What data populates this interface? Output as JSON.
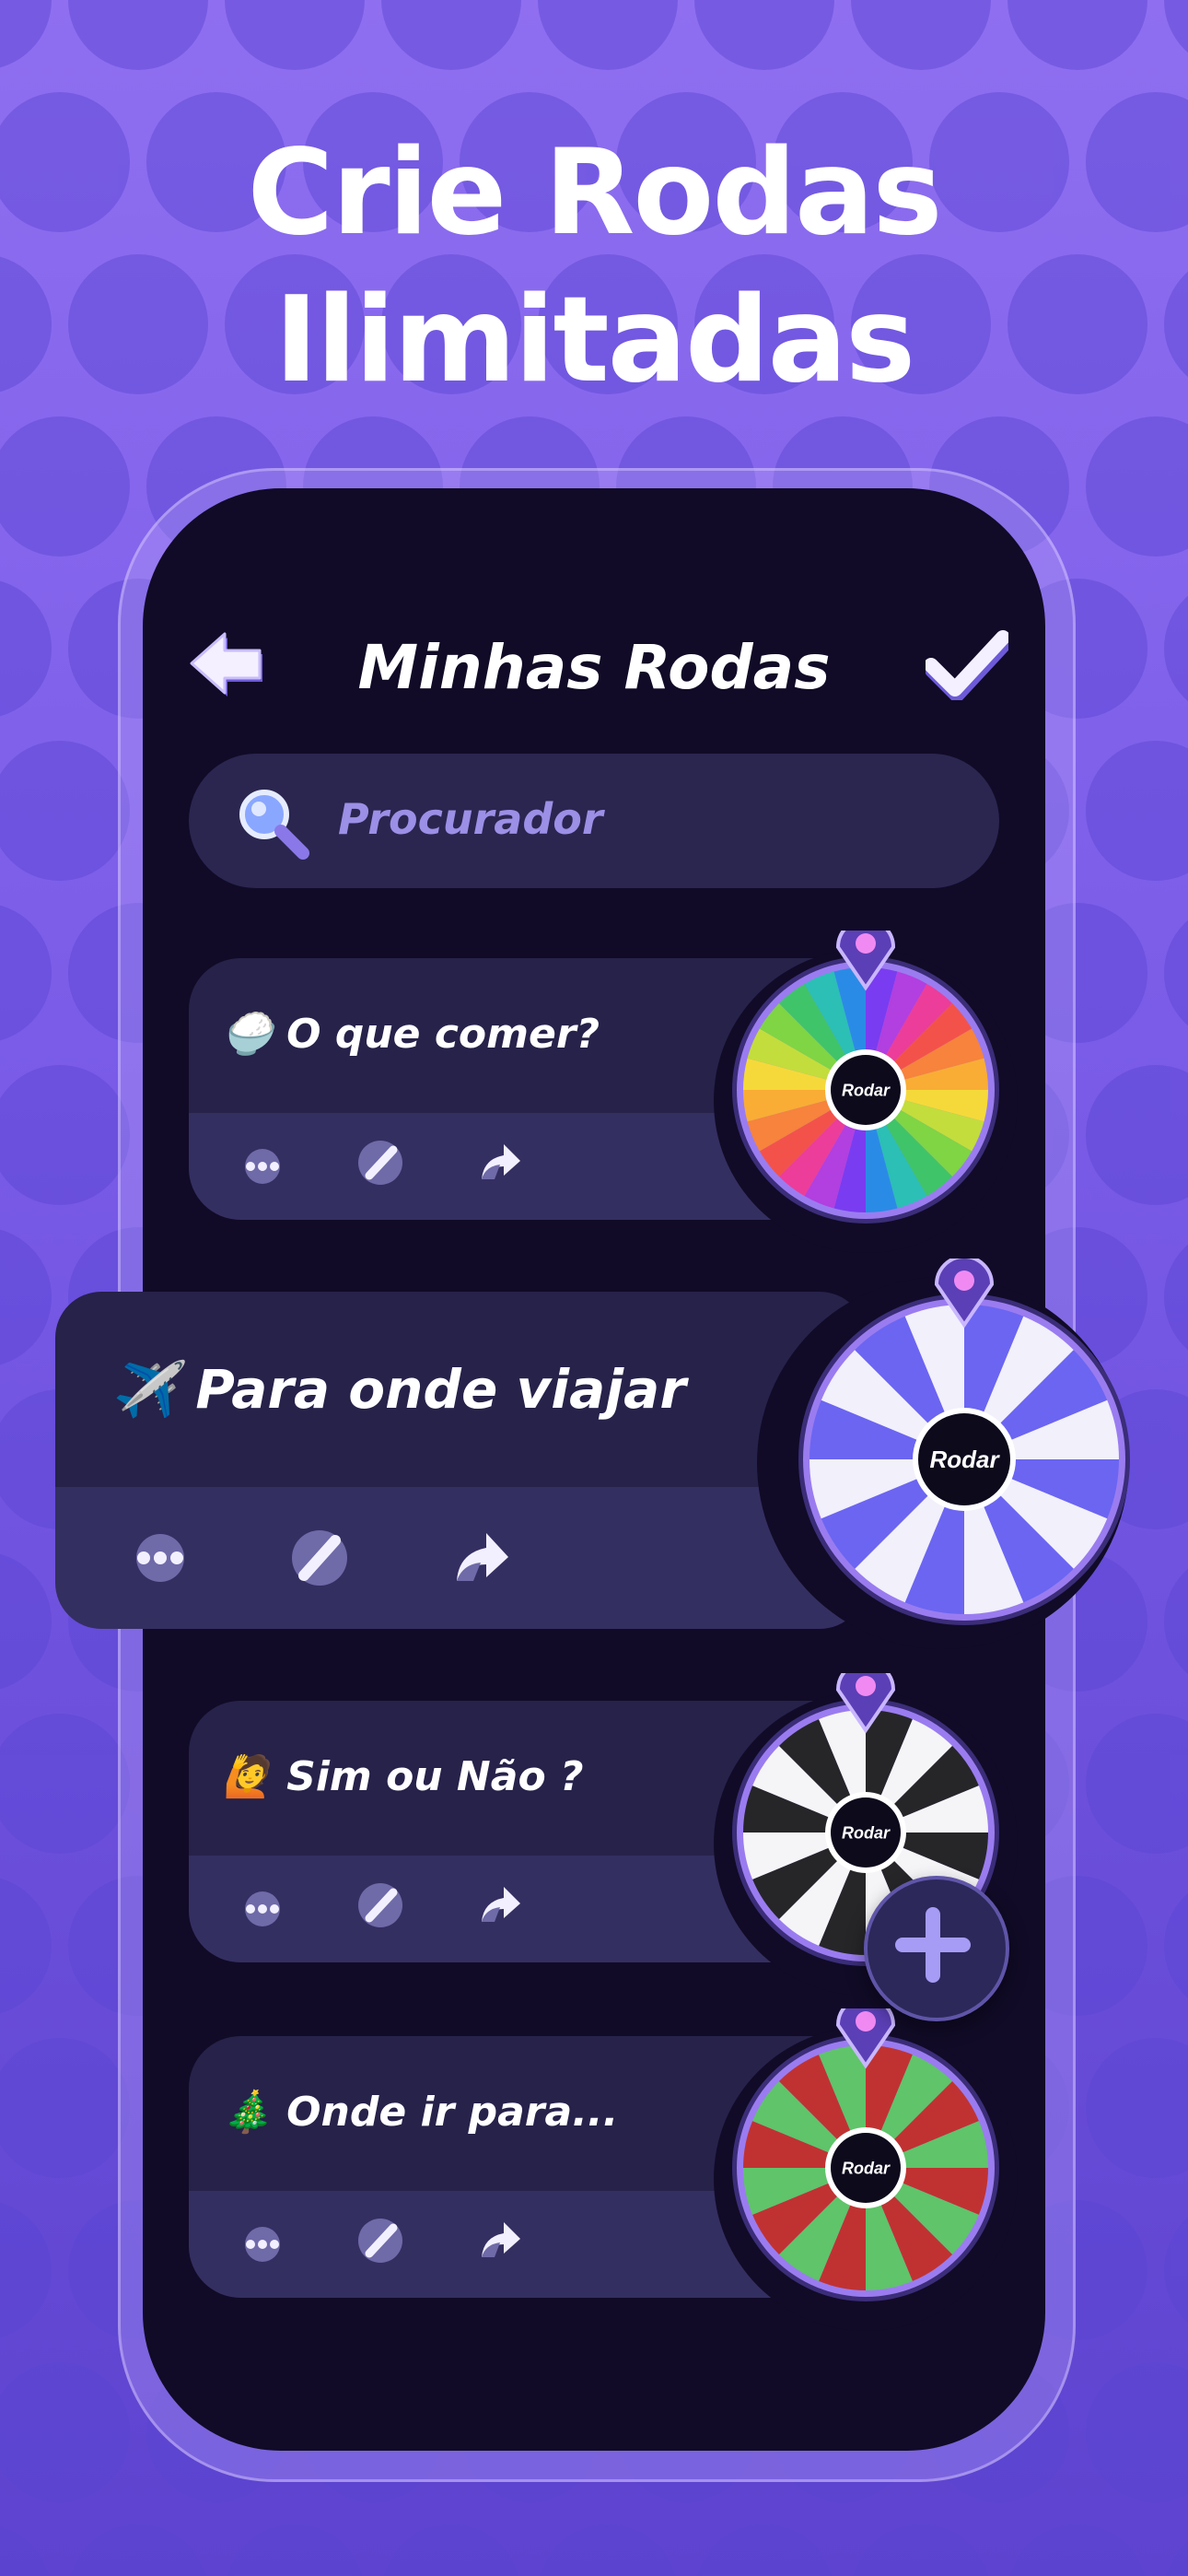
{
  "headline": {
    "line1": "Crie Rodas",
    "line2": "Ilimitadas"
  },
  "header": {
    "title": "Minhas Rodas",
    "back_icon": "back-arrow-icon",
    "confirm_icon": "check-icon"
  },
  "search": {
    "placeholder": "Procurador",
    "icon": "search-icon"
  },
  "hub_label": "Rodar",
  "cards": [
    {
      "emoji": "🍚",
      "title": "O que comer?",
      "colors": [
        "#7a3cf0",
        "#b23fe0",
        "#ec3d9a",
        "#f3524b",
        "#f7833c",
        "#f9ad35",
        "#f5d93a",
        "#c3dd3c",
        "#7fd544",
        "#3fc46a",
        "#2bbfb6",
        "#2a8be6"
      ]
    },
    {
      "emoji": "✈️",
      "title": "Para onde viajar",
      "colors": [
        "#6b65f2",
        "#f1f0fb"
      ]
    },
    {
      "emoji": "🙋",
      "title": "Sim ou Não ?",
      "colors": [
        "#262629",
        "#f5f5f7"
      ]
    },
    {
      "emoji": "🎄",
      "title": "Onde ir para...",
      "colors": [
        "#c03232",
        "#5fc46a"
      ]
    }
  ],
  "actions": {
    "more": "more-dots-icon",
    "edit": "pencil-icon",
    "share": "share-icon"
  },
  "add_button": {
    "icon": "plus-icon"
  }
}
